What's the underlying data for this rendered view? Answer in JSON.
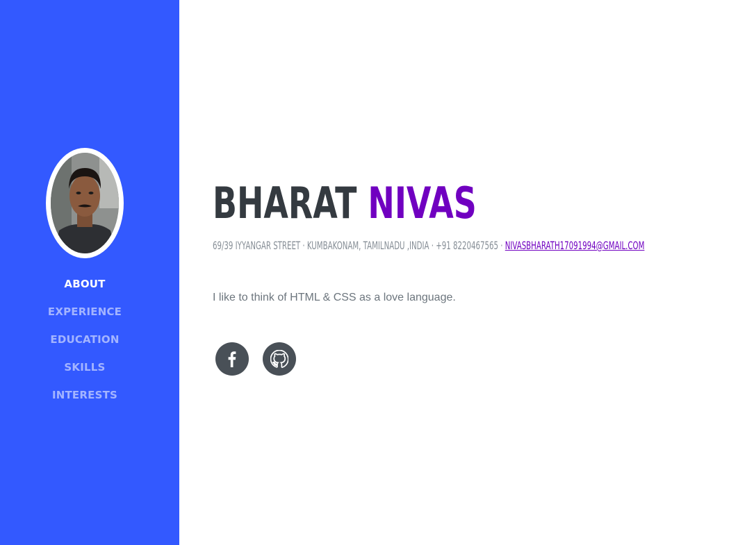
{
  "sidebar": {
    "background": "#3359ff",
    "avatar_alt": "profile-photo",
    "nav": [
      {
        "label": "ABOUT",
        "active": true
      },
      {
        "label": "EXPERIENCE",
        "active": false
      },
      {
        "label": "EDUCATION",
        "active": false
      },
      {
        "label": "SKILLS",
        "active": false
      },
      {
        "label": "INTERESTS",
        "active": false
      }
    ]
  },
  "profile": {
    "first_name": "BHARAT",
    "last_name": "NIVAS",
    "address": "69/39 IYYANGAR STREET · KUMBAKONAM, TAMILNADU ,INDIA · +91 8220467565 · ",
    "email": "NIVASBHARATH17091994@GMAIL.COM",
    "tagline": "I like to think of HTML & CSS as a love language.",
    "accent_color": "#7000c0",
    "social": [
      {
        "name": "facebook-icon"
      },
      {
        "name": "github-icon"
      }
    ]
  }
}
